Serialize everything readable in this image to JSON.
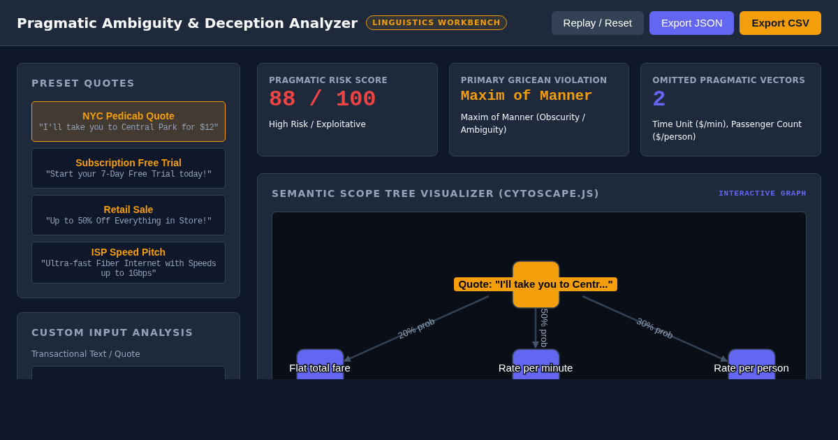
{
  "header": {
    "title": "Pragmatic Ambiguity & Deception Analyzer",
    "badge": "LINGUISTICS WORKBENCH",
    "buttons": [
      {
        "label": "Replay / Reset",
        "kind": "secondary"
      },
      {
        "label": "Export JSON",
        "kind": "primary"
      },
      {
        "label": "Export CSV",
        "kind": "accent"
      }
    ]
  },
  "presets": {
    "heading": "PRESET QUOTES",
    "items": [
      {
        "title": "NYC Pedicab Quote",
        "quote": "\"I'll take you to Central Park for $12\"",
        "selected": true
      },
      {
        "title": "Subscription Free Trial",
        "quote": "\"Start your 7-Day Free Trial today!\"",
        "selected": false
      },
      {
        "title": "Retail Sale",
        "quote": "\"Up to 50% Off Everything in Store!\"",
        "selected": false
      },
      {
        "title": "ISP Speed Pitch",
        "quote": "\"Ultra-fast Fiber Internet with Speeds up to 1Gbps\"",
        "selected": false
      }
    ]
  },
  "custom_input": {
    "heading": "CUSTOM INPUT ANALYSIS",
    "label": "Transactional Text / Quote"
  },
  "metrics": [
    {
      "kind": "risk",
      "label": "PRAGMATIC RISK SCORE",
      "value": "88 / 100",
      "description": "High Risk / Exploitative"
    },
    {
      "kind": "violation",
      "label": "PRIMARY GRICEAN VIOLATION",
      "value": "Maxim of Manner",
      "description": "Maxim of Manner (Obscurity / Ambiguity)"
    },
    {
      "kind": "count",
      "label": "OMITTED PRAGMATIC VECTORS",
      "value": "2",
      "description": "Time Unit ($/min), Passenger Count ($/person)"
    }
  ],
  "graph": {
    "title": "SEMANTIC SCOPE TREE VISUALIZER (CYTOSCAPE.JS)",
    "tag": "INTERACTIVE GRAPH",
    "root": "Quote: \"I'll take you to Centr...\"",
    "branches": [
      {
        "label": "Flat total fare",
        "edge": "20% prob"
      },
      {
        "label": "Rate per minute",
        "edge": "50% prob"
      },
      {
        "label": "Rate per person",
        "edge": "30% prob"
      }
    ]
  }
}
